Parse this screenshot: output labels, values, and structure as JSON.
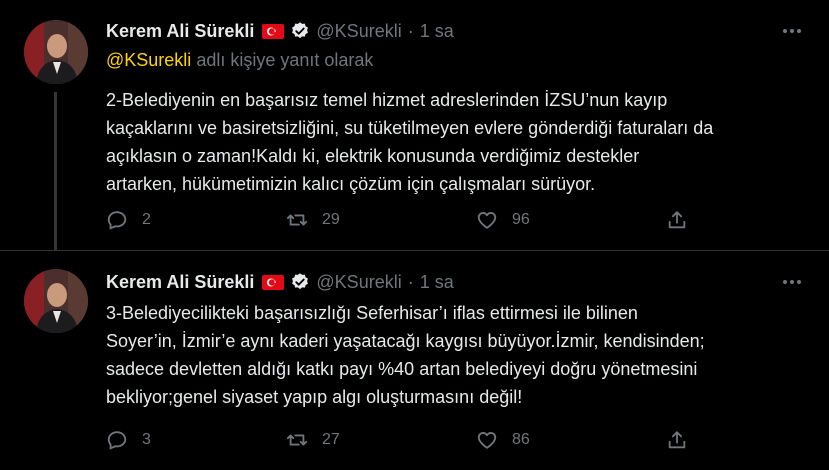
{
  "colors": {
    "background": "#000000",
    "text": "#e7e9ea",
    "muted": "#71767b",
    "link": "#ffd400",
    "divider": "#2f3336"
  },
  "tweets": [
    {
      "name": "Kerem Ali Sürekli",
      "handle": "@KSurekli",
      "dot": "·",
      "time": "1 sa",
      "reply_to_handle": "@KSurekli",
      "reply_to_suffix": " adlı kişiye yanıt olarak",
      "text": "2-Belediyenin en başarısız temel hizmet adreslerinden İZSU’nun kayıp\nkaçaklarını ve basiretsizliğini, su tüketilmeyen evlere gönderdiği faturaları da\naçıklasın o zaman!Kaldı ki, elektrik konusunda verdiğimiz destekler\nartarken, hükümetimizin kalıcı çözüm için çalışmaları sürüyor.",
      "replies": "2",
      "retweets": "29",
      "likes": "96"
    },
    {
      "name": "Kerem Ali Sürekli",
      "handle": "@KSurekli",
      "dot": "·",
      "time": "1 sa",
      "text": "3-Belediyecilikteki başarısızlığı Seferhisar’ı iflas ettirmesi ile bilinen\nSoyer’in, İzmir’e aynı kaderi yaşatacağı kaygısı büyüyor.İzmir, kendisinden;\nsadece devletten aldığı katkı payı %40 artan belediyeyi doğru yönetmesini\nbekliyor;genel siyaset yapıp algı oluşturmasını değil!",
      "replies": "3",
      "retweets": "27",
      "likes": "86"
    }
  ],
  "icons": [
    "turkey-flag-icon",
    "verified-badge-icon",
    "more-icon",
    "reply-icon",
    "retweet-icon",
    "like-icon",
    "share-icon"
  ]
}
